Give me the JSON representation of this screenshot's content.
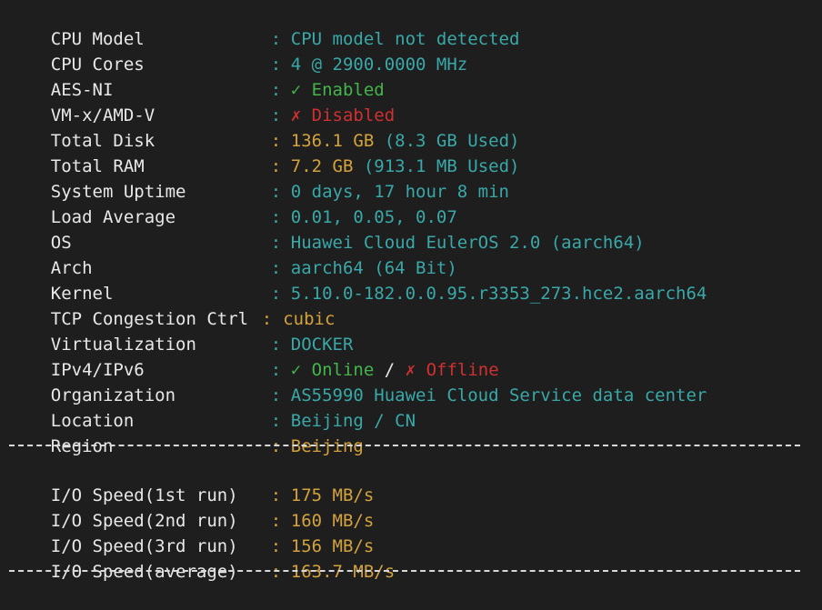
{
  "rows": [
    {
      "label": "CPU Model",
      "sep": ":",
      "value": "CPU model not detected"
    },
    {
      "label": "CPU Cores",
      "sep": ":",
      "value": "4 @ 2900.0000 MHz"
    },
    {
      "label": "AES-NI",
      "sep": ":",
      "mark": "✓",
      "value": "Enabled"
    },
    {
      "label": "VM-x/AMD-V",
      "sep": ":",
      "mark": "✗",
      "value": "Disabled"
    },
    {
      "label": "Total Disk",
      "sep": ":",
      "value_main": "136.1 GB",
      "value_extra": "(8.3 GB Used)"
    },
    {
      "label": "Total RAM",
      "sep": ":",
      "value_main": "7.2 GB",
      "value_extra": "(913.1 MB Used)"
    },
    {
      "label": "System Uptime",
      "sep": ":",
      "value": "0 days, 17 hour 8 min"
    },
    {
      "label": "Load Average",
      "sep": ":",
      "value": "0.01, 0.05, 0.07"
    },
    {
      "label": "OS",
      "sep": ":",
      "value": "Huawei Cloud EulerOS 2.0 (aarch64)"
    },
    {
      "label": "Arch",
      "sep": ":",
      "value": "aarch64 (64 Bit)"
    },
    {
      "label": "Kernel",
      "sep": ":",
      "value": "5.10.0-182.0.0.95.r3353_273.hce2.aarch64"
    },
    {
      "label": "TCP Congestion Ctrl",
      "sep": ":",
      "value": "cubic"
    },
    {
      "label": "Virtualization",
      "sep": ":",
      "value": "DOCKER"
    },
    {
      "label": "IPv4/IPv6",
      "sep": ":",
      "ipv4_mark": "✓",
      "ipv4_value": "Online",
      "slash": "/",
      "ipv6_mark": "✗",
      "ipv6_value": "Offline"
    },
    {
      "label": "Organization",
      "sep": ":",
      "value": "AS55990 Huawei Cloud Service data center"
    },
    {
      "label": "Location",
      "sep": ":",
      "value": "Beijing / CN"
    },
    {
      "label": "Region",
      "sep": ":",
      "value": "Beijing"
    }
  ],
  "io": [
    {
      "label": "I/O Speed(1st run)",
      "sep": ":",
      "value": "175 MB/s"
    },
    {
      "label": "I/O Speed(2nd run)",
      "sep": ":",
      "value": "160 MB/s"
    },
    {
      "label": "I/O Speed(3rd run)",
      "sep": ":",
      "value": "156 MB/s"
    },
    {
      "label": "I/O Speed(average)",
      "sep": ":",
      "value": "163.7 MB/s"
    }
  ],
  "colors": {
    "background": "#1e1e1e",
    "label": "#e8e8e8",
    "cyan": "#3aa8a8",
    "yellow": "#d4a23c",
    "green": "#43b54b",
    "red": "#d03030"
  }
}
